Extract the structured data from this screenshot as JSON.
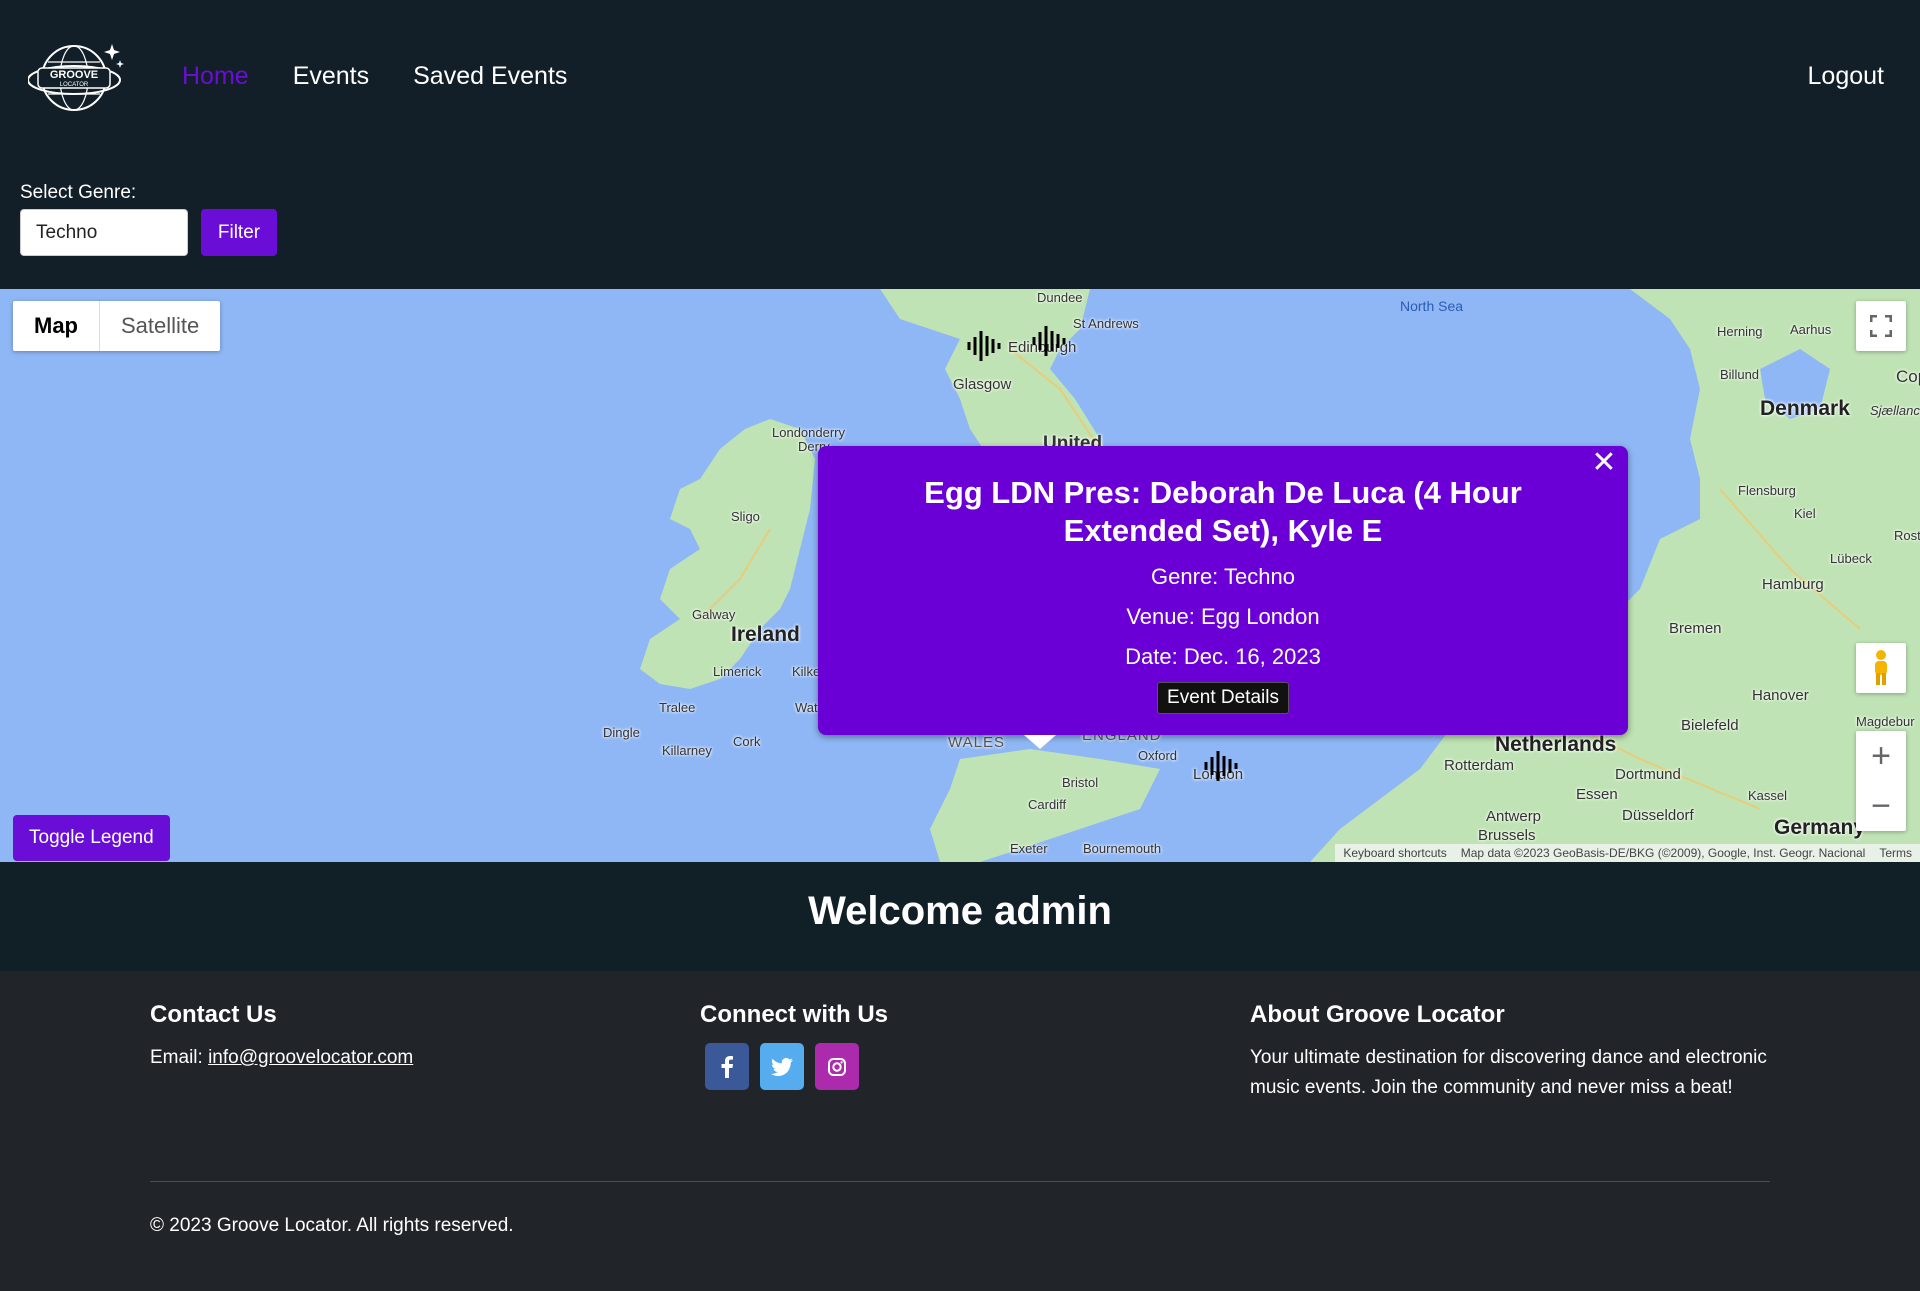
{
  "header": {
    "logo_top": "GROOVE",
    "logo_bottom": "LOCATOR",
    "nav": [
      {
        "label": "Home",
        "active": true
      },
      {
        "label": "Events",
        "active": false
      },
      {
        "label": "Saved Events",
        "active": false
      }
    ],
    "logout_label": "Logout"
  },
  "filter": {
    "label": "Select Genre:",
    "selected_genre": "Techno",
    "button_label": "Filter"
  },
  "map": {
    "type_controls": {
      "map_label": "Map",
      "satellite_label": "Satellite",
      "selected": "Map"
    },
    "toggle_legend_label": "Toggle Legend",
    "zoom_in": "+",
    "zoom_out": "−",
    "attribution": {
      "keyboard": "Keyboard shortcuts",
      "data": "Map data ©2023 GeoBasis-DE/BKG (©2009), Google, Inst. Geogr. Nacional",
      "terms": "Terms"
    },
    "labels": {
      "north_sea": "North Sea",
      "dundee": "Dundee",
      "st_andrews": "St Andrews",
      "edinburgh": "Edinburgh",
      "glasgow": "Glasgow",
      "londonderry": "Londonderry",
      "derry": "Derry",
      "united": "United",
      "sligo": "Sligo",
      "galway": "Galway",
      "ireland": "Ireland",
      "limerick": "Limerick",
      "kilkenny": "Kilke",
      "tralee": "Tralee",
      "waterford": "Wat",
      "dingle": "Dingle",
      "killarney": "Killarney",
      "cork": "Cork",
      "wales": "WALES",
      "england": "ENGLAND",
      "oxford": "Oxford",
      "london": "London",
      "bristol": "Bristol",
      "cardiff": "Cardiff",
      "exeter": "Exeter",
      "bournemouth": "Bournemouth",
      "herning": "Herning",
      "aarhus": "Aarhus",
      "billund": "Billund",
      "denmark": "Denmark",
      "copenhagen": "Cop",
      "sjaelland": "Sjællanc",
      "flensburg": "Flensburg",
      "kiel": "Kiel",
      "rostock": "Rost",
      "lubeck": "Lübeck",
      "hamburg": "Hamburg",
      "bremen": "Bremen",
      "hanover": "Hanover",
      "magdeburg": "Magdebur",
      "bielefeld": "Bielefeld",
      "netherlands": "Netherlands",
      "rotterdam": "Rotterdam",
      "dortmund": "Dortmund",
      "essen": "Essen",
      "kassel": "Kassel",
      "antwerp": "Antwerp",
      "dusseldorf": "Düsseldorf",
      "brussels": "Brussels",
      "germany": "Germany"
    }
  },
  "info_window": {
    "title": "Egg LDN Pres: Deborah De Luca (4 Hour Extended Set), Kyle E",
    "genre": "Genre: Techno",
    "venue": "Venue: Egg London",
    "date": "Date: Dec. 16, 2023",
    "button_label": "Event Details",
    "close_symbol": "✕"
  },
  "welcome": "Welcome admin",
  "footer": {
    "contact": {
      "heading": "Contact Us",
      "email_prefix": "Email: ",
      "email": "info@groovelocator.com"
    },
    "connect": {
      "heading": "Connect with Us",
      "icons": [
        "facebook-icon",
        "twitter-icon",
        "instagram-icon"
      ]
    },
    "about": {
      "heading": "About Groove Locator",
      "text": "Your ultimate destination for discovering dance and electronic music events. Join the community and never miss a beat!"
    },
    "copyright": "© 2023 Groove Locator. All rights reserved."
  },
  "colors": {
    "accent": "#6a0dd6",
    "header_bg": "#121f28",
    "footer_bg": "#212529",
    "facebook": "#3b5998",
    "twitter": "#55acee",
    "instagram": "#ac2bac",
    "water": "#8fb7f5",
    "land": "#bfe3b4"
  }
}
